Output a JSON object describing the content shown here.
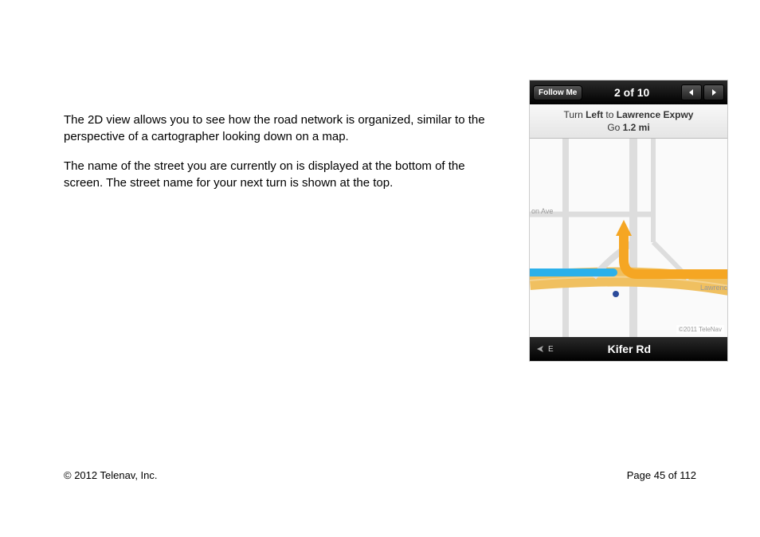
{
  "body": {
    "paragraph1": "The 2D view allows you to see how the road network is organized, similar to the perspective of a cartographer looking down on a map.",
    "paragraph2": "The name of the street you are currently on is displayed at the bottom of the screen. The street name for your next turn is shown at the top."
  },
  "phone": {
    "follow_label": "Follow Me",
    "step_counter": "2 of 10",
    "instruction_prefix": "Turn ",
    "instruction_direction": "Left",
    "instruction_mid": " to ",
    "instruction_dest": "Lawrence Expwy",
    "instruction_go": "Go ",
    "instruction_dist": "1.2 mi",
    "compass_dir": "E",
    "current_street": "Kifer Rd",
    "map_label_ave": "on Ave",
    "map_label_lawrence": "Lawrenc",
    "map_copyright": "©2011 TeleNav"
  },
  "footer": {
    "copyright": "© 2012 Telenav, Inc.",
    "page": "Page 45 of 112"
  }
}
